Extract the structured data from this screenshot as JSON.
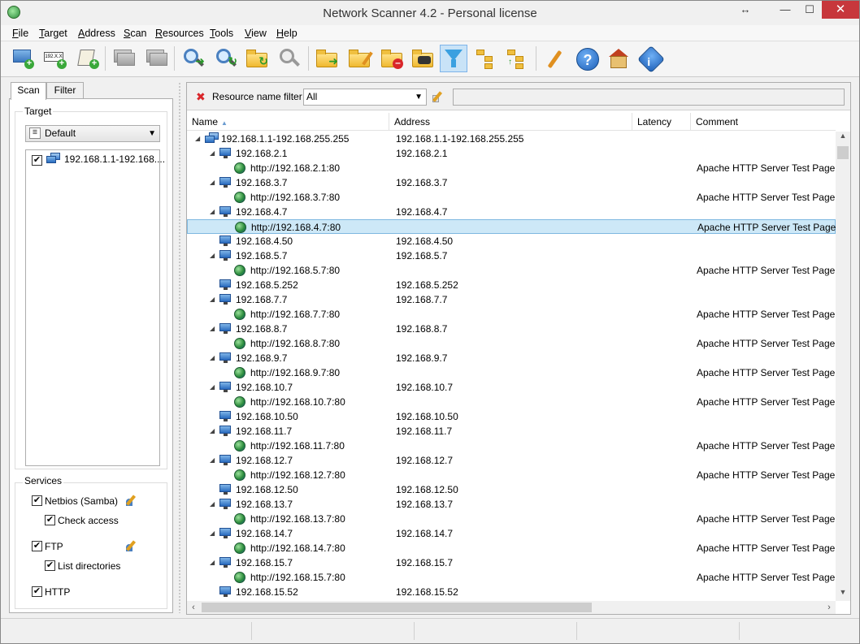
{
  "window": {
    "title": "Network Scanner 4.2 - Personal license",
    "close": "✕",
    "minimize": "—",
    "maximize": "☐",
    "resize": "↔"
  },
  "menu": {
    "items": [
      {
        "key": "F",
        "rest": "ile"
      },
      {
        "key": "T",
        "rest": "arget"
      },
      {
        "key": "A",
        "rest": "ddress"
      },
      {
        "key": "S",
        "rest": "can"
      },
      {
        "key": "R",
        "rest": "esources"
      },
      {
        "key": "T",
        "rest": "ools"
      },
      {
        "key": "V",
        "rest": "iew"
      },
      {
        "key": "H",
        "rest": "elp"
      }
    ]
  },
  "toolbar": {
    "address_chip": "192.X.X"
  },
  "left": {
    "tabs": [
      "Scan",
      "Filter"
    ],
    "target_label": "Target",
    "target_combo": "Default",
    "target_item": "192.168.1.1-192.168....",
    "services_label": "Services",
    "services": [
      {
        "label": "Netbios (Samba)",
        "checked": "✔"
      },
      {
        "label": "Check access",
        "checked": "✔"
      },
      {
        "label": "FTP",
        "checked": "✔"
      },
      {
        "label": "List directories",
        "checked": "✔"
      },
      {
        "label": "HTTP",
        "checked": "✔"
      }
    ]
  },
  "filter": {
    "label": "Resource name filter",
    "combo_value": "All",
    "input_value": ""
  },
  "grid": {
    "columns": [
      "Name",
      "Address",
      "Latency",
      "Comment"
    ],
    "rows": [
      {
        "type": "range",
        "expand": "◢",
        "name": "192.168.1.1-192.168.255.255",
        "address": "192.168.1.1-192.168.255.255",
        "latency": "",
        "comment": ""
      },
      {
        "type": "host",
        "expand": "◢",
        "name": "192.168.2.1",
        "address": "192.168.2.1",
        "latency": "",
        "comment": ""
      },
      {
        "type": "http",
        "expand": "",
        "name": "http://192.168.2.1:80",
        "address": "",
        "latency": "",
        "comment": "Apache HTTP Server Test Page po"
      },
      {
        "type": "host",
        "expand": "◢",
        "name": "192.168.3.7",
        "address": "192.168.3.7",
        "latency": "",
        "comment": ""
      },
      {
        "type": "http",
        "expand": "",
        "name": "http://192.168.3.7:80",
        "address": "",
        "latency": "",
        "comment": "Apache HTTP Server Test Page po"
      },
      {
        "type": "host",
        "expand": "◢",
        "name": "192.168.4.7",
        "address": "192.168.4.7",
        "latency": "",
        "comment": ""
      },
      {
        "type": "http",
        "expand": "",
        "name": "http://192.168.4.7:80",
        "address": "",
        "latency": "",
        "comment": "Apache HTTP Server Test Page po",
        "selected": true
      },
      {
        "type": "host",
        "expand": "",
        "name": "192.168.4.50",
        "address": "192.168.4.50",
        "latency": "",
        "comment": ""
      },
      {
        "type": "host",
        "expand": "◢",
        "name": "192.168.5.7",
        "address": "192.168.5.7",
        "latency": "",
        "comment": ""
      },
      {
        "type": "http",
        "expand": "",
        "name": "http://192.168.5.7:80",
        "address": "",
        "latency": "",
        "comment": "Apache HTTP Server Test Page po"
      },
      {
        "type": "host",
        "expand": "",
        "name": "192.168.5.252",
        "address": "192.168.5.252",
        "latency": "",
        "comment": ""
      },
      {
        "type": "host",
        "expand": "◢",
        "name": "192.168.7.7",
        "address": "192.168.7.7",
        "latency": "",
        "comment": ""
      },
      {
        "type": "http",
        "expand": "",
        "name": "http://192.168.7.7:80",
        "address": "",
        "latency": "",
        "comment": "Apache HTTP Server Test Page po"
      },
      {
        "type": "host",
        "expand": "◢",
        "name": "192.168.8.7",
        "address": "192.168.8.7",
        "latency": "",
        "comment": ""
      },
      {
        "type": "http",
        "expand": "",
        "name": "http://192.168.8.7:80",
        "address": "",
        "latency": "",
        "comment": "Apache HTTP Server Test Page po"
      },
      {
        "type": "host",
        "expand": "◢",
        "name": "192.168.9.7",
        "address": "192.168.9.7",
        "latency": "",
        "comment": ""
      },
      {
        "type": "http",
        "expand": "",
        "name": "http://192.168.9.7:80",
        "address": "",
        "latency": "",
        "comment": "Apache HTTP Server Test Page po"
      },
      {
        "type": "host",
        "expand": "◢",
        "name": "192.168.10.7",
        "address": "192.168.10.7",
        "latency": "",
        "comment": ""
      },
      {
        "type": "http",
        "expand": "",
        "name": "http://192.168.10.7:80",
        "address": "",
        "latency": "",
        "comment": "Apache HTTP Server Test Page po"
      },
      {
        "type": "host",
        "expand": "",
        "name": "192.168.10.50",
        "address": "192.168.10.50",
        "latency": "",
        "comment": ""
      },
      {
        "type": "host",
        "expand": "◢",
        "name": "192.168.11.7",
        "address": "192.168.11.7",
        "latency": "",
        "comment": ""
      },
      {
        "type": "http",
        "expand": "",
        "name": "http://192.168.11.7:80",
        "address": "",
        "latency": "",
        "comment": "Apache HTTP Server Test Page po"
      },
      {
        "type": "host",
        "expand": "◢",
        "name": "192.168.12.7",
        "address": "192.168.12.7",
        "latency": "",
        "comment": ""
      },
      {
        "type": "http",
        "expand": "",
        "name": "http://192.168.12.7:80",
        "address": "",
        "latency": "",
        "comment": "Apache HTTP Server Test Page po"
      },
      {
        "type": "host",
        "expand": "",
        "name": "192.168.12.50",
        "address": "192.168.12.50",
        "latency": "",
        "comment": ""
      },
      {
        "type": "host",
        "expand": "◢",
        "name": "192.168.13.7",
        "address": "192.168.13.7",
        "latency": "",
        "comment": ""
      },
      {
        "type": "http",
        "expand": "",
        "name": "http://192.168.13.7:80",
        "address": "",
        "latency": "",
        "comment": "Apache HTTP Server Test Page po"
      },
      {
        "type": "host",
        "expand": "◢",
        "name": "192.168.14.7",
        "address": "192.168.14.7",
        "latency": "",
        "comment": ""
      },
      {
        "type": "http",
        "expand": "",
        "name": "http://192.168.14.7:80",
        "address": "",
        "latency": "",
        "comment": "Apache HTTP Server Test Page po"
      },
      {
        "type": "host",
        "expand": "◢",
        "name": "192.168.15.7",
        "address": "192.168.15.7",
        "latency": "",
        "comment": ""
      },
      {
        "type": "http",
        "expand": "",
        "name": "http://192.168.15.7:80",
        "address": "",
        "latency": "",
        "comment": "Apache HTTP Server Test Page po"
      },
      {
        "type": "host",
        "expand": "",
        "name": "192.168.15.52",
        "address": "192.168.15.52",
        "latency": "",
        "comment": ""
      }
    ]
  },
  "colors": {
    "selection": "#cde8f7",
    "close_button": "#c7373c",
    "accent": "#3aa0e0"
  },
  "icons": [
    "app-icon",
    "add-computer-icon",
    "add-address-icon",
    "add-script-icon",
    "computers-icon",
    "computer-remove-icon",
    "scan-icon",
    "rescan-icon",
    "refresh-folders-icon",
    "stop-scan-icon",
    "open-folder-icon",
    "edit-folder-icon",
    "remove-folder-icon",
    "binoculars-icon",
    "filter-icon",
    "tree-expand-icon",
    "tree-collapse-icon",
    "options-icon",
    "help-icon",
    "home-icon",
    "about-icon"
  ]
}
